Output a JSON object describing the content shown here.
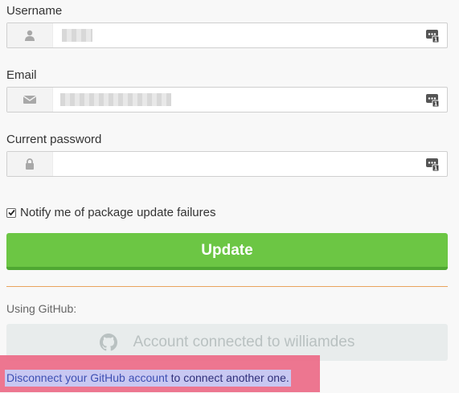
{
  "form": {
    "username": {
      "label": "Username",
      "value": "",
      "icon": "user-icon"
    },
    "email": {
      "label": "Email",
      "value": "",
      "icon": "envelope-icon"
    },
    "current_password": {
      "label": "Current password",
      "value": "",
      "icon": "lock-icon"
    },
    "password_manager_icon": "password-manager-icon",
    "notify_checkbox": {
      "label": "Notify me of package update failures",
      "checked": true
    },
    "update_button": "Update"
  },
  "github": {
    "label": "Using GitHub:",
    "connected_button": "Account connected to williamdes",
    "disconnect_link": "Disconnect your GitHub account",
    "disconnect_suffix": " to connect another one."
  },
  "colors": {
    "update_green": "#6cc644",
    "divider_orange": "#e9a35d",
    "highlight_pink": "#ec6f8a",
    "selection_lavender": "#c8c8f2"
  }
}
